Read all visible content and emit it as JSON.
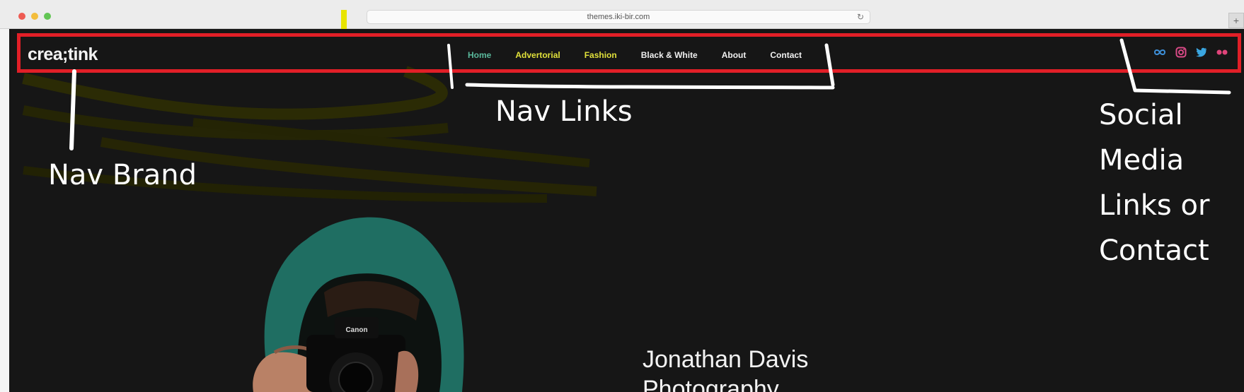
{
  "browser": {
    "url": "themes.iki-bir.com",
    "new_tab_label": "+"
  },
  "site": {
    "brand": "crea;tink",
    "nav": [
      {
        "label": "Home"
      },
      {
        "label": "Advertorial"
      },
      {
        "label": "Fashion"
      },
      {
        "label": "Black & White"
      },
      {
        "label": "About"
      },
      {
        "label": "Contact"
      }
    ],
    "social_icons": [
      "infinity-icon",
      "instagram-icon",
      "twitter-icon",
      "flickr-icon"
    ]
  },
  "hero": {
    "name": "Jonathan Davis",
    "subtitle": "Photography",
    "camera_brand": "Canon"
  },
  "annotations": {
    "nav_brand": "Nav Brand",
    "nav_links": "Nav Links",
    "social_lines": [
      "Social",
      "Media",
      "Links or",
      "Contact"
    ]
  },
  "colors": {
    "page_bg": "#161616",
    "accent_green": "#5ab99c",
    "accent_yellow": "#e1e13a",
    "highlight_red": "#e11f27",
    "pink": "#e0447a"
  }
}
